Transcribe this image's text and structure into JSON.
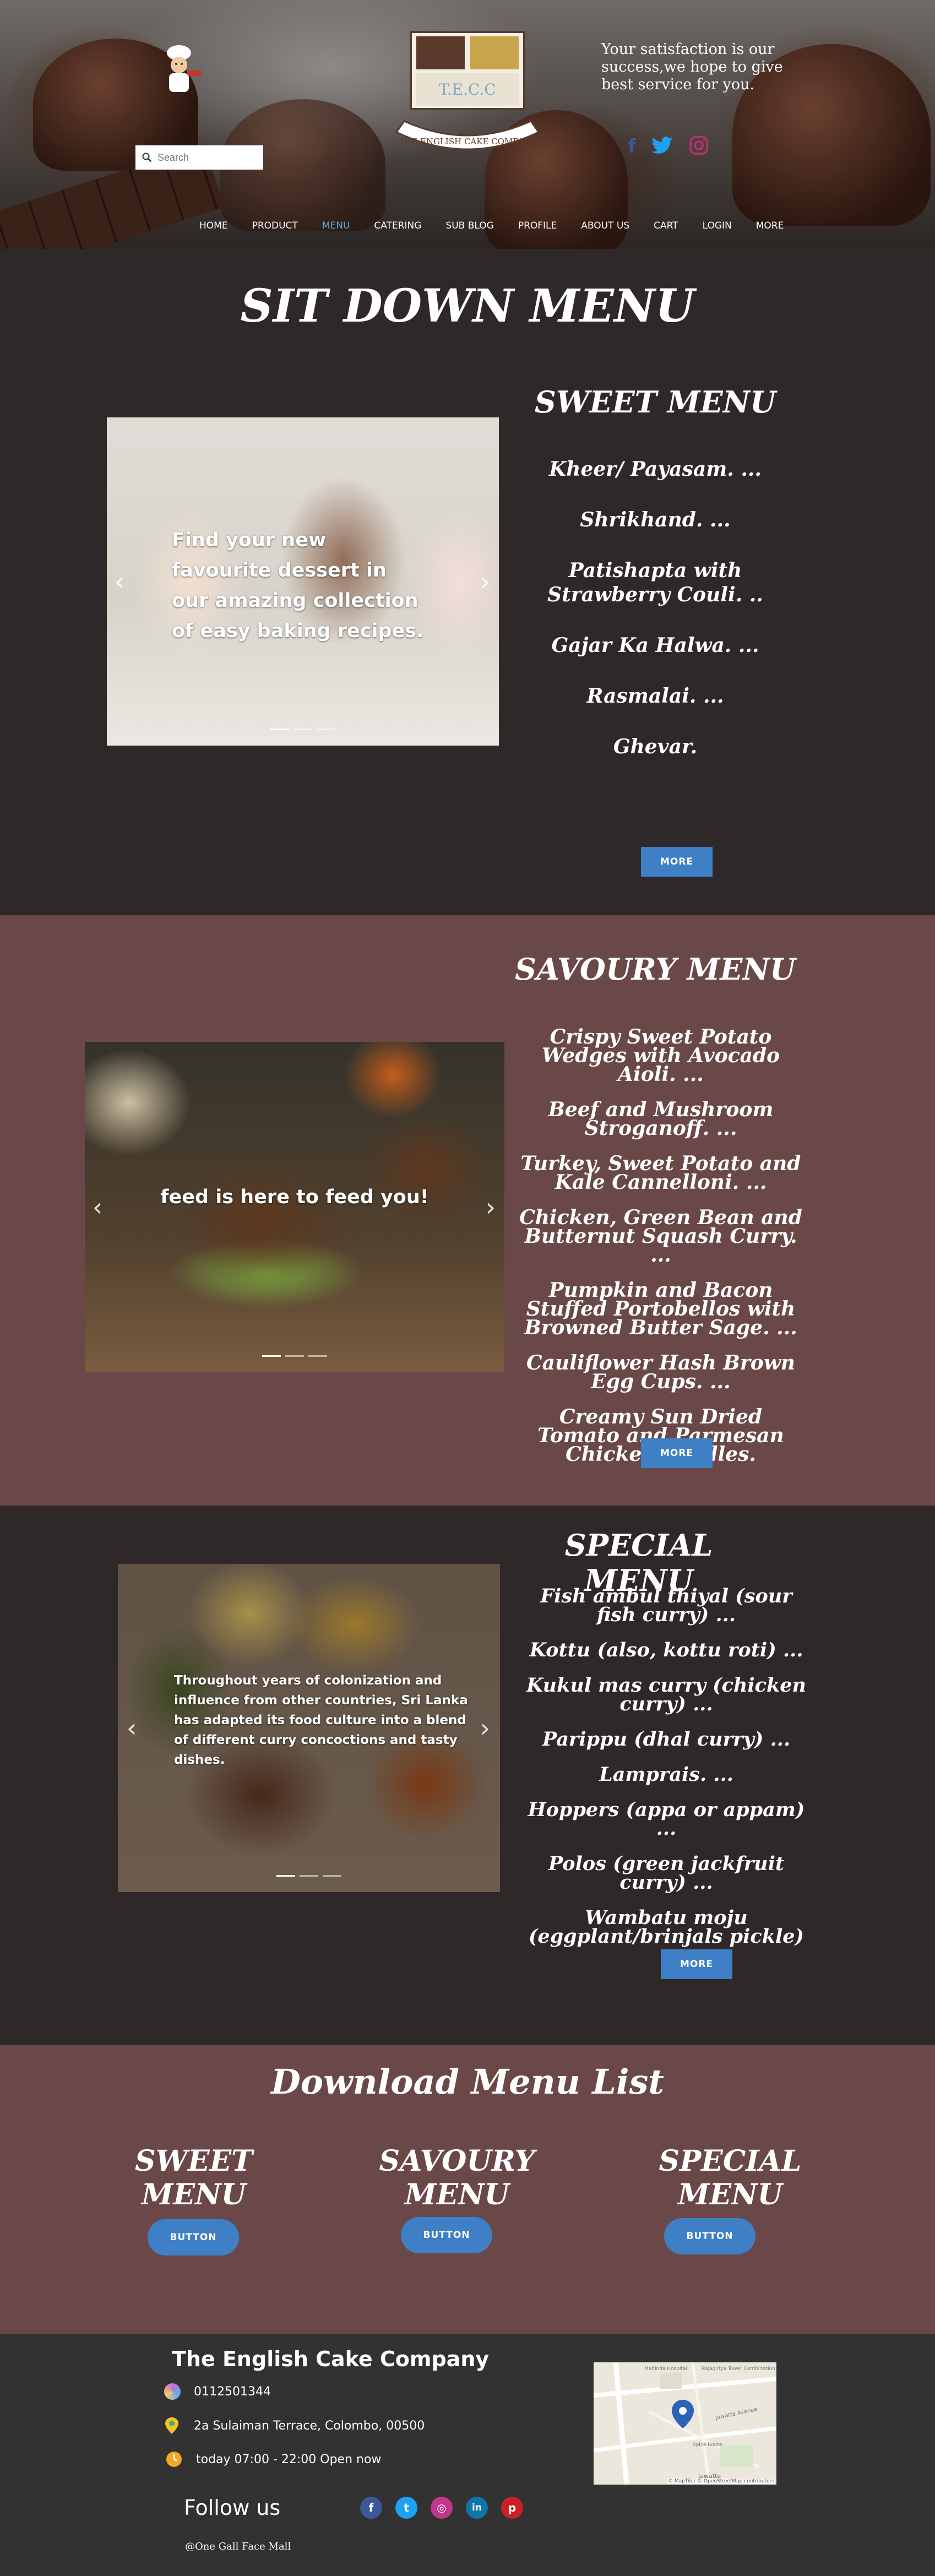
{
  "header": {
    "logo_initials": "T.E.C.C",
    "logo_banner": "THE ENGLISH CAKE COMPANY",
    "tagline": "Your satisfaction is our success,we hope to give best service for you.",
    "search_placeholder": "Search",
    "nav": [
      "HOME",
      "PRODUCT",
      "MENU",
      "CATERING",
      "SUB BLOG",
      "PROFILE",
      "ABOUT US",
      "CART",
      "LOGIN",
      "MORE"
    ],
    "active_nav": "MENU",
    "social": [
      "facebook-icon",
      "twitter-icon",
      "instagram-icon"
    ]
  },
  "sitdown": {
    "title": "SIT DOWN MENU",
    "sweet_heading": "SWEET MENU",
    "slider_caption": "Find your new favourite dessert in our amazing collection of easy baking recipes.",
    "items": [
      "Kheer/ Payasam. ...",
      "Shrikhand. ...",
      "Patishapta with Strawberry Couli. ..",
      "Gajar Ka Halwa. ...",
      "Rasmalai. ...",
      "Ghevar."
    ],
    "more_label": "MORE"
  },
  "savoury": {
    "heading": "SAVOURY MENU",
    "slider_caption": "feed is here to feed you!",
    "items": [
      "Crispy Sweet Potato Wedges with Avocado Aioli. ...",
      "Beef and Mushroom Stroganoff. ...",
      "Turkey, Sweet Potato and Kale Cannelloni. ...",
      "Chicken, Green Bean and Butternut Squash Curry. ...",
      "Pumpkin and Bacon Stuffed Portobellos with Browned Butter Sage. ...",
      "Cauliflower Hash Brown Egg Cups. ...",
      "Creamy Sun Dried Tomato and Parmesan Chicken Zoodles."
    ],
    "more_label": "MORE"
  },
  "special": {
    "heading": "SPECIAL MENU",
    "slider_caption": "Throughout years of colonization and influence from other countries, Sri Lanka has adapted its food culture into a blend of different curry concoctions and tasty dishes.",
    "items": [
      "Fish ambul thiyal (sour fish curry) ...",
      "Kottu (also, kottu roti) ...",
      "Kukul mas curry (chicken curry) ...",
      "Parippu (dhal curry) ...",
      "Lamprais. ...",
      "Hoppers (appa or appam) ...",
      "Polos (green jackfruit curry) ...",
      "Wambatu moju (eggplant/brinjals pickle)"
    ],
    "more_label": "MORE"
  },
  "download": {
    "title": "Download Menu List",
    "columns": [
      {
        "heading": "SWEET MENU",
        "button": "BUTTON"
      },
      {
        "heading": "SAVOURY MENU",
        "button": "BUTTON"
      },
      {
        "heading": "SPECIAL MENU",
        "button": "BUTTON"
      }
    ]
  },
  "footer": {
    "company": "The English Cake Company",
    "phone": "0112501344",
    "address": "2a Sulaiman Terrace, Colombo, 00500",
    "hours": "today 07:00 - 22:00 Open now",
    "follow": "Follow us",
    "follow_icons": [
      "facebook-icon",
      "twitter-icon",
      "instagram-icon",
      "linkedin-icon",
      "pinterest-icon"
    ],
    "location_note": "@One Gall Face Mall",
    "map_labels": [
      "Jawatte",
      "Jawatte Avenue",
      "Spice Route",
      "Rajagiriya Tower Combination Pitt",
      "Mahinda Hospital"
    ],
    "map_credit": "© MapTiler © OpenStreetMap contributors"
  }
}
